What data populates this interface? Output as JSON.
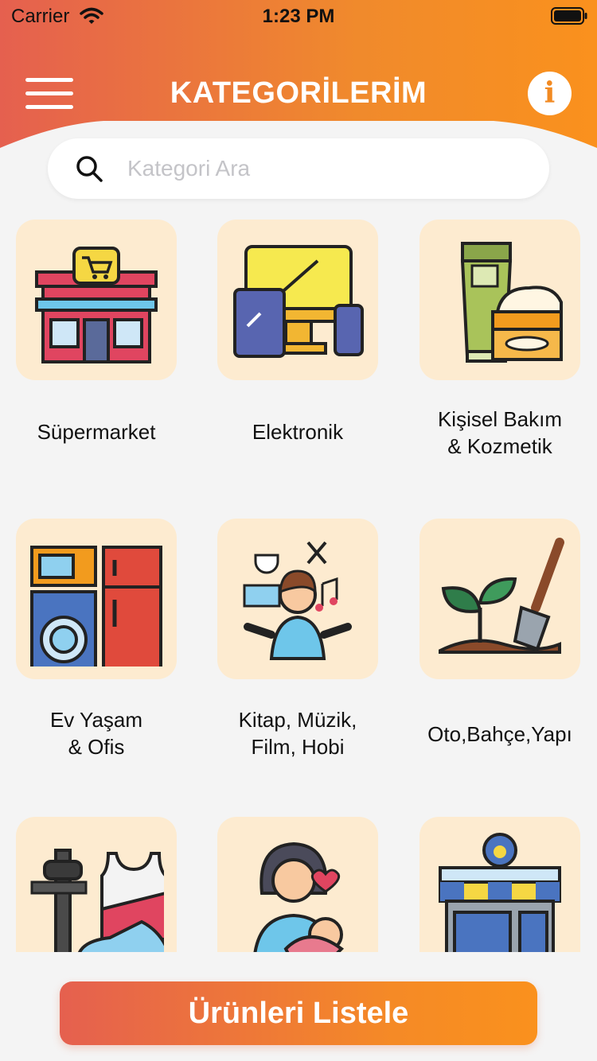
{
  "status_bar": {
    "carrier": "Carrier",
    "time": "1:23 PM"
  },
  "header": {
    "title": "KATEGORİLERİM",
    "info_label": "i"
  },
  "search": {
    "placeholder": "Kategori Ara",
    "value": ""
  },
  "categories": [
    {
      "label": "Süpermarket",
      "icon": "supermarket-icon"
    },
    {
      "label": "Elektronik",
      "icon": "electronics-icon"
    },
    {
      "label": "Kişisel Bakım\n& Kozmetik",
      "icon": "cosmetics-icon"
    },
    {
      "label": "Ev Yaşam\n& Ofis",
      "icon": "appliances-icon"
    },
    {
      "label": "Kitap, Müzik,\nFilm, Hobi",
      "icon": "hobby-icon"
    },
    {
      "label": "Oto,Bahçe,Yapı",
      "icon": "garden-icon"
    },
    {
      "label": "",
      "icon": "sports-icon"
    },
    {
      "label": "",
      "icon": "mother-baby-icon"
    },
    {
      "label": "",
      "icon": "pet-shop-icon"
    }
  ],
  "cta": {
    "label": "Ürünleri Listele"
  },
  "colors": {
    "accent_start": "#e5604f",
    "accent_end": "#fa911d",
    "tile_bg": "#fdebd0",
    "background": "#f4f4f4"
  }
}
